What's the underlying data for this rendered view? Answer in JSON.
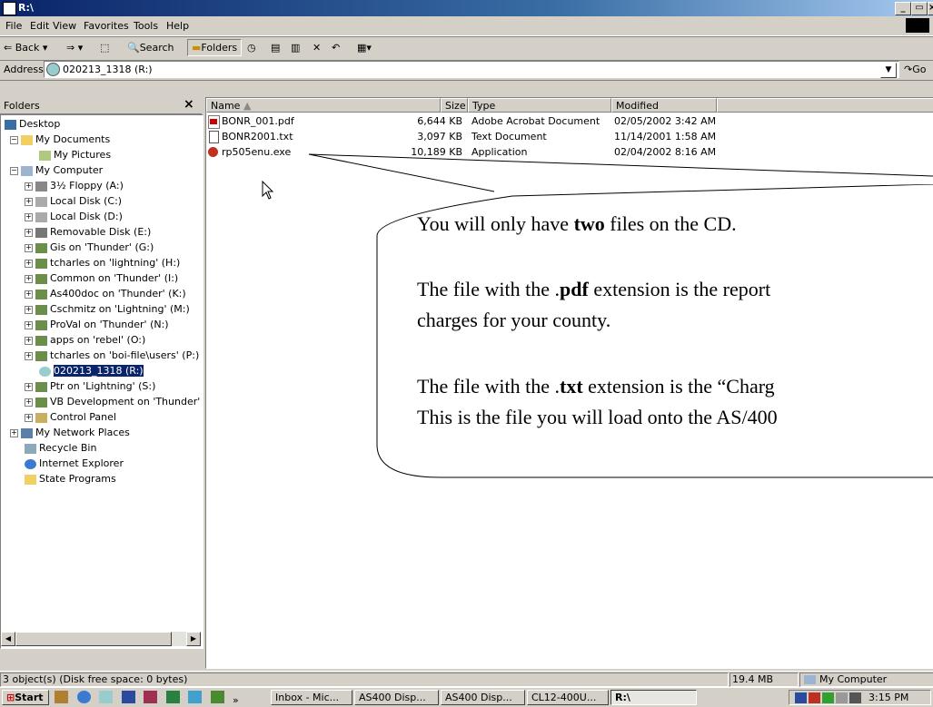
{
  "window": {
    "title": "R:\\",
    "min": "_",
    "max": "▭",
    "close": "×"
  },
  "menu": [
    "File",
    "Edit",
    "View",
    "Favorites",
    "Tools",
    "Help"
  ],
  "toolbar": {
    "back": "Back",
    "search": "Search",
    "folders": "Folders"
  },
  "address": {
    "label": "Address",
    "value": "020213_1318 (R:)",
    "go": "Go"
  },
  "folders_pane": {
    "title": "Folders",
    "close": "×",
    "items": [
      {
        "label": "Desktop"
      },
      {
        "label": "My Documents"
      },
      {
        "label": "My Pictures"
      },
      {
        "label": "My Computer"
      },
      {
        "label": "3½ Floppy (A:)"
      },
      {
        "label": "Local Disk (C:)"
      },
      {
        "label": "Local Disk (D:)"
      },
      {
        "label": "Removable Disk (E:)"
      },
      {
        "label": "Gis on 'Thunder' (G:)"
      },
      {
        "label": "tcharles on 'lightning' (H:)"
      },
      {
        "label": "Common on 'Thunder' (I:)"
      },
      {
        "label": "As400doc on 'Thunder' (K:)"
      },
      {
        "label": "Cschmitz on 'Lightning' (M:)"
      },
      {
        "label": "ProVal on 'Thunder' (N:)"
      },
      {
        "label": "apps on 'rebel' (O:)"
      },
      {
        "label": "tcharles on 'boi-file\\users' (P:)"
      },
      {
        "label": "020213_1318 (R:)"
      },
      {
        "label": "Ptr on 'Lightning' (S:)"
      },
      {
        "label": "VB Development on 'Thunder' ("
      },
      {
        "label": "Control Panel"
      },
      {
        "label": "My Network Places"
      },
      {
        "label": "Recycle Bin"
      },
      {
        "label": "Internet Explorer"
      },
      {
        "label": "State Programs"
      }
    ]
  },
  "list": {
    "columns": [
      "Name",
      "Size",
      "Type",
      "Modified"
    ],
    "sort_arrow": "▲",
    "rows": [
      {
        "name": "BONR_001.pdf",
        "size": "6,644 KB",
        "type": "Adobe Acrobat Document",
        "modified": "02/05/2002 3:42 AM"
      },
      {
        "name": "BONR2001.txt",
        "size": "3,097 KB",
        "type": "Text Document",
        "modified": "11/14/2001 1:58 AM"
      },
      {
        "name": "rp505enu.exe",
        "size": "10,189 KB",
        "type": "Application",
        "modified": "02/04/2002 8:16 AM"
      }
    ]
  },
  "callout": {
    "line1_a": "You will only have ",
    "line1_b": "two",
    "line1_c": " files on the CD.",
    "line2_a": "The file with the .",
    "line2_b": "pdf",
    "line2_c": " extension is the report",
    "line3": "charges for your county.",
    "line4_a": "The file with the .",
    "line4_b": "txt",
    "line4_c": " extension is the “Charg",
    "line5": "This is the file you will load onto the AS/400"
  },
  "status": {
    "left": "3 object(s) (Disk free space: 0 bytes)",
    "size": "19.4 MB",
    "zone": "My Computer"
  },
  "taskbar": {
    "start": "Start",
    "more": "»",
    "tasks": [
      "Inbox - Mic...",
      "AS400 Disp...",
      "AS400 Disp...",
      "CL12-400U...",
      "R:\\"
    ],
    "clock": "3:15 PM"
  },
  "colors": {
    "title_start": "#0a246a",
    "title_end": "#a6caf0",
    "selection": "#0a246a",
    "face": "#d4d0c8"
  }
}
